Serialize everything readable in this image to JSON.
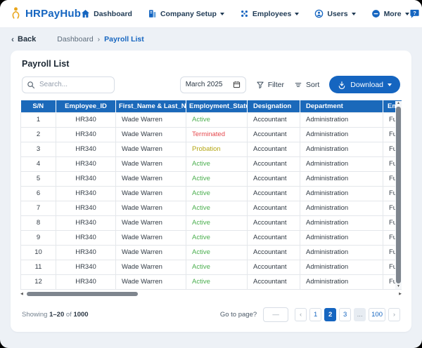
{
  "colors": {
    "primary": "#1565c0",
    "table_header_bg": "#1b69ba",
    "status_active": "#4caf50",
    "status_terminated": "#e5484d",
    "status_probation": "#b3a512"
  },
  "navbar": {
    "brand": "HRPayHub",
    "items": [
      {
        "label": "Dashboard",
        "has_caret": false
      },
      {
        "label": "Company Setup",
        "has_caret": true
      },
      {
        "label": "Employees",
        "has_caret": true
      },
      {
        "label": "Users",
        "has_caret": true
      },
      {
        "label": "More",
        "has_caret": true
      }
    ]
  },
  "breadcrumb": {
    "back_label": "Back",
    "parent": "Dashboard",
    "current": "Payroll List"
  },
  "page": {
    "title": "Payroll List"
  },
  "controls": {
    "search_placeholder": "Search...",
    "date_value": "March 2025",
    "filter_label": "Filter",
    "sort_label": "Sort",
    "download_label": "Download"
  },
  "table": {
    "columns": [
      "S/N",
      "Employee_ID",
      "First_Name & Last_Name",
      "Employment_Status",
      "Designation",
      "Department",
      "Employment_Type"
    ],
    "rows": [
      {
        "sn": "1",
        "employee_id": "HR340",
        "name": "Wade Warren",
        "status": "Active",
        "designation": "Accountant",
        "department": "Administration",
        "type": "Full Time"
      },
      {
        "sn": "2",
        "employee_id": "HR340",
        "name": "Wade Warren",
        "status": "Terminated",
        "designation": "Accountant",
        "department": "Administration",
        "type": "Full Time"
      },
      {
        "sn": "3",
        "employee_id": "HR340",
        "name": "Wade Warren",
        "status": "Probation",
        "designation": "Accountant",
        "department": "Administration",
        "type": "Full Time"
      },
      {
        "sn": "4",
        "employee_id": "HR340",
        "name": "Wade Warren",
        "status": "Active",
        "designation": "Accountant",
        "department": "Administration",
        "type": "Full Time"
      },
      {
        "sn": "5",
        "employee_id": "HR340",
        "name": "Wade Warren",
        "status": "Active",
        "designation": "Accountant",
        "department": "Administration",
        "type": "Full Time"
      },
      {
        "sn": "6",
        "employee_id": "HR340",
        "name": "Wade Warren",
        "status": "Active",
        "designation": "Accountant",
        "department": "Administration",
        "type": "Full Time"
      },
      {
        "sn": "7",
        "employee_id": "HR340",
        "name": "Wade Warren",
        "status": "Active",
        "designation": "Accountant",
        "department": "Administration",
        "type": "Full Time"
      },
      {
        "sn": "8",
        "employee_id": "HR340",
        "name": "Wade Warren",
        "status": "Active",
        "designation": "Accountant",
        "department": "Administration",
        "type": "Full Time"
      },
      {
        "sn": "9",
        "employee_id": "HR340",
        "name": "Wade Warren",
        "status": "Active",
        "designation": "Accountant",
        "department": "Administration",
        "type": "Full Time"
      },
      {
        "sn": "10",
        "employee_id": "HR340",
        "name": "Wade Warren",
        "status": "Active",
        "designation": "Accountant",
        "department": "Administration",
        "type": "Full Time"
      },
      {
        "sn": "11",
        "employee_id": "HR340",
        "name": "Wade Warren",
        "status": "Active",
        "designation": "Accountant",
        "department": "Administration",
        "type": "Full Time"
      },
      {
        "sn": "12",
        "employee_id": "HR340",
        "name": "Wade Warren",
        "status": "Active",
        "designation": "Accountant",
        "department": "Administration",
        "type": "Full Time"
      }
    ]
  },
  "footer": {
    "showing_prefix": "Showing",
    "showing_range": "1–20",
    "showing_of": "of",
    "showing_total": "1000",
    "goto_label": "Go to page?",
    "goto_placeholder": "—",
    "pagination": [
      {
        "label": "‹",
        "kind": "nav"
      },
      {
        "label": "1",
        "kind": "page"
      },
      {
        "label": "2",
        "kind": "page",
        "active": true
      },
      {
        "label": "3",
        "kind": "page"
      },
      {
        "label": "...",
        "kind": "ellipsis"
      },
      {
        "label": "100",
        "kind": "page"
      },
      {
        "label": "›",
        "kind": "nav"
      }
    ]
  }
}
